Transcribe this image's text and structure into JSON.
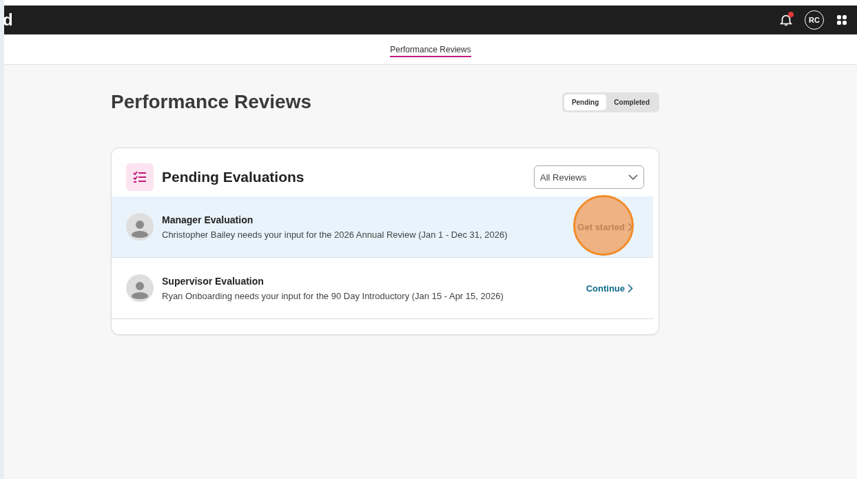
{
  "topbar": {
    "logo": "d",
    "avatar_initials": "RC",
    "notification_unread": true
  },
  "subnav": {
    "tabs": [
      {
        "label": "Performance Reviews",
        "selected": true
      }
    ]
  },
  "page": {
    "title": "Performance Reviews",
    "toggle": [
      {
        "label": "Pending",
        "selected": true
      },
      {
        "label": "Completed",
        "selected": false
      }
    ]
  },
  "card": {
    "title": "Pending Evaluations",
    "filter": {
      "value": "All Reviews"
    },
    "items": [
      {
        "title": "Manager Evaluation",
        "description": "Christopher Bailey needs your input for the 2026 Annual Review (Jan 1 - Dec 31, 2026)",
        "action": "Get started",
        "highlighted": true,
        "click_marker": true
      },
      {
        "title": "Supervisor Evaluation",
        "description": "Ryan Onboarding needs your input for the 90 Day Introductory (Jan 15 - Apr 15, 2026)",
        "action": "Continue",
        "highlighted": false,
        "click_marker": false
      }
    ]
  }
}
